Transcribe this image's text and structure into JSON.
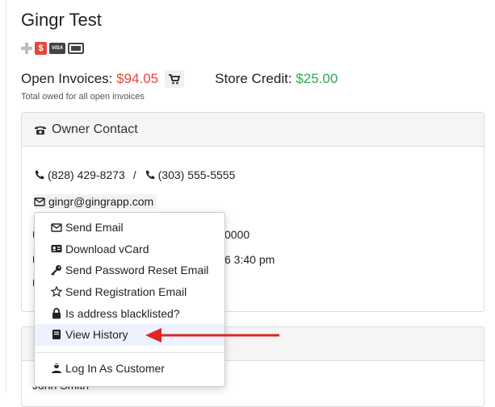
{
  "customer": {
    "name": "Gingr Test",
    "badges": [
      "plus-icon",
      "dollar-icon",
      "visa-icon",
      "card-icon"
    ]
  },
  "billing": {
    "open_invoices_label": "Open Invoices:",
    "open_invoices_amount": "$94.05",
    "store_credit_label": "Store Credit:",
    "store_credit_amount": "$25.00",
    "note": "Total owed for all open invoices"
  },
  "owner_contact": {
    "title": "Owner Contact",
    "phone1": "(828) 429-8273",
    "separator": "/",
    "phone2": "(303) 555-5555",
    "email": "gingr@gingrapp.com",
    "obscured_text_1": "0000",
    "obscured_text_2": "6 3:40 pm"
  },
  "context_menu": {
    "items": [
      {
        "label": "Send Email",
        "icon": "envelope-icon"
      },
      {
        "label": "Download vCard",
        "icon": "id-card-icon"
      },
      {
        "label": "Send Password Reset Email",
        "icon": "key-icon"
      },
      {
        "label": "Send Registration Email",
        "icon": "star-icon"
      },
      {
        "label": "Is address blacklisted?",
        "icon": "lock-icon"
      },
      {
        "label": "View History",
        "icon": "book-icon"
      }
    ],
    "footer_item": {
      "label": "Log In As Customer",
      "icon": "user-icon"
    }
  },
  "second_panel": {
    "peek_name": "John Smith"
  },
  "colors": {
    "invoice_red": "#e8453c",
    "credit_green": "#2fa84f",
    "arrow_red": "#e0261f",
    "highlight": "#eef2ff"
  }
}
